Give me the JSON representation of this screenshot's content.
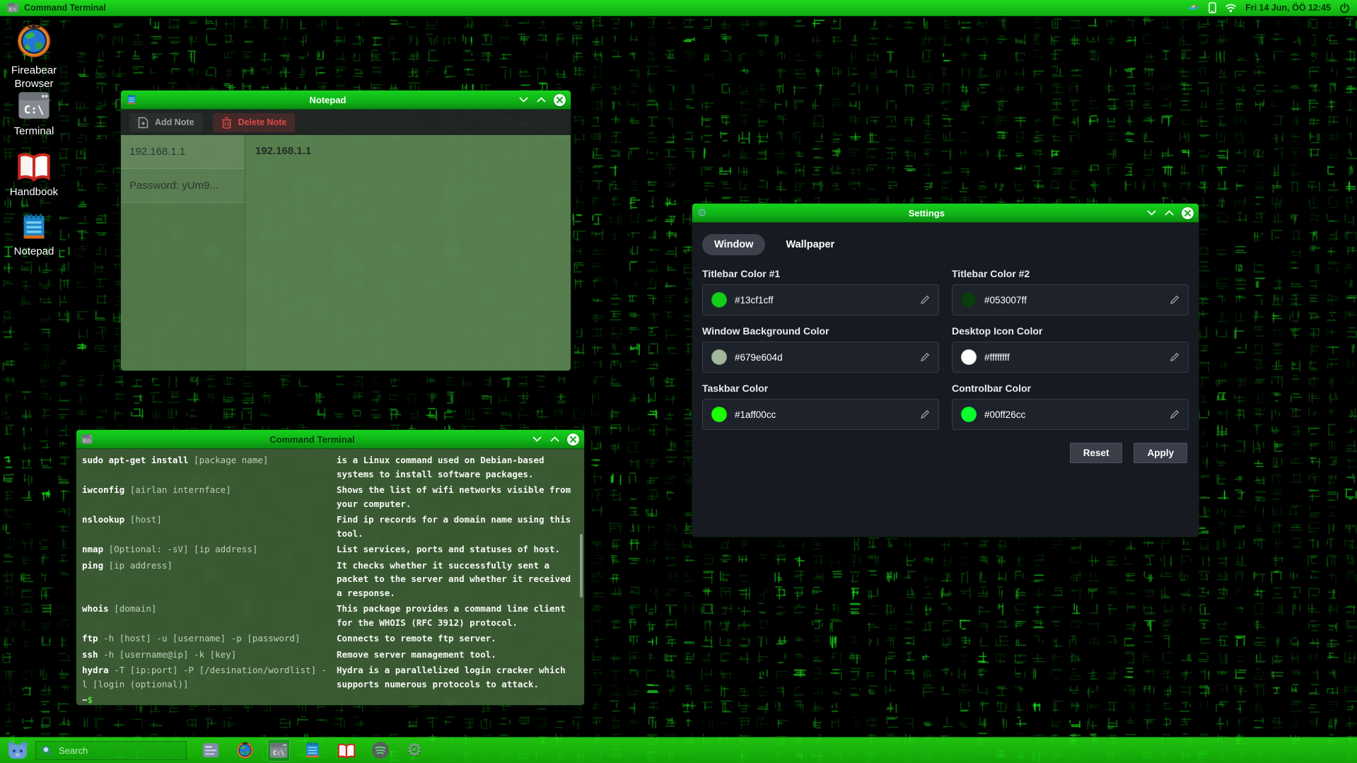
{
  "topbar": {
    "title": "Command Terminal",
    "clock": "Fri 14 Jun, ÖÖ 12:45",
    "tray_icons": [
      "swallow-icon",
      "phone-icon",
      "wifi-icon",
      "power-icon"
    ]
  },
  "desktop": {
    "icons": [
      {
        "id": "fireabear-browser",
        "label": "Fireabear Browser"
      },
      {
        "id": "terminal",
        "label": "Terminal",
        "icon_text": "C:\\"
      },
      {
        "id": "handbook",
        "label": "Handbook"
      },
      {
        "id": "notepad",
        "label": "Notepad"
      }
    ]
  },
  "notepad_window": {
    "title": "Notepad",
    "toolbar": {
      "add": "Add Note",
      "delete": "Delete Note"
    },
    "notes": [
      {
        "label": "192.168.1.1",
        "selected": true
      },
      {
        "label": "Password: yUm9...",
        "selected": false
      }
    ],
    "content": "192.168.1.1"
  },
  "settings_window": {
    "title": "Settings",
    "tabs": [
      {
        "label": "Window",
        "active": true
      },
      {
        "label": "Wallpaper",
        "active": false
      }
    ],
    "fields": [
      {
        "label": "Titlebar Color #1",
        "value": "#13cf1cff",
        "swatch": "#13cf1c"
      },
      {
        "label": "Titlebar Color #2",
        "value": "#053007ff",
        "swatch": "#0a3c0e"
      },
      {
        "label": "Window Background Color",
        "value": "#679e604d",
        "swatch": "#a3b99c"
      },
      {
        "label": "Desktop Icon Color",
        "value": "#ffffffff",
        "swatch": "#ffffff"
      },
      {
        "label": "Taskbar Color",
        "value": "#1aff00cc",
        "swatch": "#1dff04"
      },
      {
        "label": "Controlbar Color",
        "value": "#00ff26cc",
        "swatch": "#0aff2e"
      }
    ],
    "reset_label": "Reset",
    "apply_label": "Apply"
  },
  "terminal_window": {
    "title": "Command Terminal",
    "entries": [
      {
        "cmd": "sudo apt-get install",
        "args": " [package name]",
        "desc": "is a Linux command used on Debian-based systems to install software packages."
      },
      {
        "cmd": "iwconfig",
        "args": " [airlan internface]",
        "desc": "Shows the list of wifi networks visible from your computer."
      },
      {
        "cmd": "nslookup",
        "args": " [host]",
        "desc": "Find ip records for a domain name using this tool."
      },
      {
        "cmd": "nmap",
        "args": " [Optional: -sV] [ip address]",
        "desc": "List services, ports and statuses of host."
      },
      {
        "cmd": "ping",
        "args": " [ip address]",
        "desc": "It checks whether it successfully sent a packet to the server and whether it received a response."
      },
      {
        "cmd": "whois",
        "args": " [domain]",
        "desc": "This package provides a command line client for the WHOIS (RFC 3912) protocol."
      },
      {
        "cmd": "ftp",
        "args": " -h [host] -u [username] -p [password]",
        "desc": "Connects to remote ftp server."
      },
      {
        "cmd": "ssh",
        "args": " -h [username@ip] -k [key]",
        "desc": "Remove server management tool."
      },
      {
        "cmd": "hydra",
        "args": " -T [ip:port] -P [/desination/wordlist] -l [login (optional)]",
        "desc": "Hydra is a parallelized login cracker which supports numerous protocols to attack."
      }
    ],
    "prompt_tilde": "~",
    "prompt_dollar": "$"
  },
  "taskbar": {
    "search_placeholder": "Search",
    "items": [
      {
        "id": "file-manager",
        "active": false
      },
      {
        "id": "fireabear-browser",
        "active": false
      },
      {
        "id": "terminal",
        "active": true
      },
      {
        "id": "notepad",
        "active": false
      },
      {
        "id": "handbook",
        "active": false
      },
      {
        "id": "spotify",
        "active": false
      },
      {
        "id": "settings",
        "active": false
      }
    ]
  },
  "theme": {
    "titlebar_color_1": "#13cf1c",
    "titlebar_color_2": "#053007",
    "window_background": "#679e60",
    "desktop_icon_color": "#ffffff",
    "taskbar_color": "#1aff00",
    "controlbar_color": "#00ff26"
  }
}
